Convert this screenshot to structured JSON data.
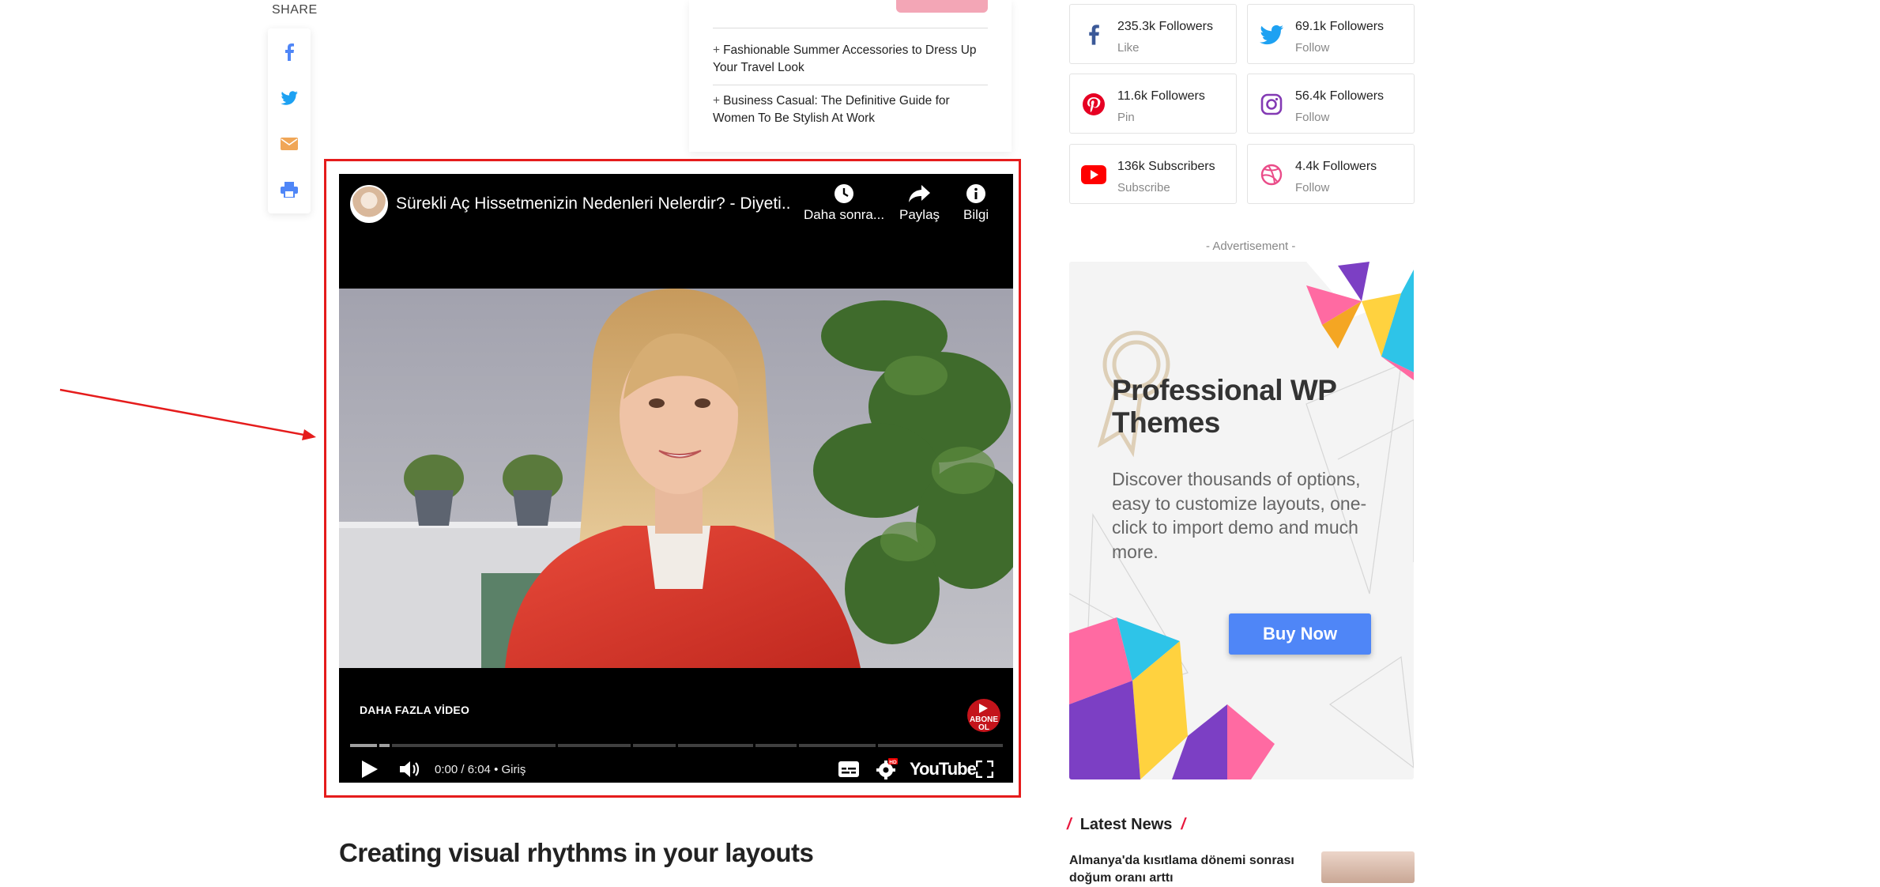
{
  "share": {
    "label": "SHARE",
    "buttons": [
      "facebook-icon",
      "twitter-icon",
      "email-icon",
      "print-icon"
    ]
  },
  "related": {
    "items": [
      "Fashionable Summer Accessories to Dress Up Your Travel Look",
      "Business Casual: The Definitive Guide for Women To Be Stylish At Work"
    ]
  },
  "video": {
    "title": "Sürekli Aç Hissetmenizin Nedenleri Nelerdir? - Diyeti...",
    "watch_later": "Daha sonra...",
    "share": "Paylaş",
    "info": "Bilgi",
    "more_videos": "DAHA FAZLA VİDEO",
    "subscribe_badge": "ABONE OL",
    "time": "0:00 / 6:04",
    "chapter": "Giriş",
    "brand": "YouTube",
    "hd_badge": "HD"
  },
  "social": [
    {
      "network": "facebook",
      "count": "235.3k Followers",
      "action": "Like",
      "color": "#3b5998"
    },
    {
      "network": "twitter",
      "count": "69.1k Followers",
      "action": "Follow",
      "color": "#1da1f2"
    },
    {
      "network": "pinterest",
      "count": "11.6k Followers",
      "action": "Pin",
      "color": "#e60023"
    },
    {
      "network": "instagram",
      "count": "56.4k Followers",
      "action": "Follow",
      "color": "#833ab4"
    },
    {
      "network": "youtube",
      "count": "136k Subscribers",
      "action": "Subscribe",
      "color": "#ff0000"
    },
    {
      "network": "dribbble",
      "count": "4.4k Followers",
      "action": "Follow",
      "color": "#ea4c89"
    }
  ],
  "ad": {
    "label": "- Advertisement -",
    "title": "Professional WP Themes",
    "description": "Discover thousands of options, easy to customize layouts, one-click to import demo and much more.",
    "button": "Buy Now",
    "button_color": "#4f86f7"
  },
  "latest_news": {
    "heading": "Latest News",
    "first_title": "Almanya'da kısıtlama dönemi sonrası doğum oranı arttı"
  },
  "article": {
    "heading": "Creating visual rhythms in your layouts"
  },
  "colors": {
    "highlight": "#e51c1c",
    "accent": "#e8173d"
  }
}
